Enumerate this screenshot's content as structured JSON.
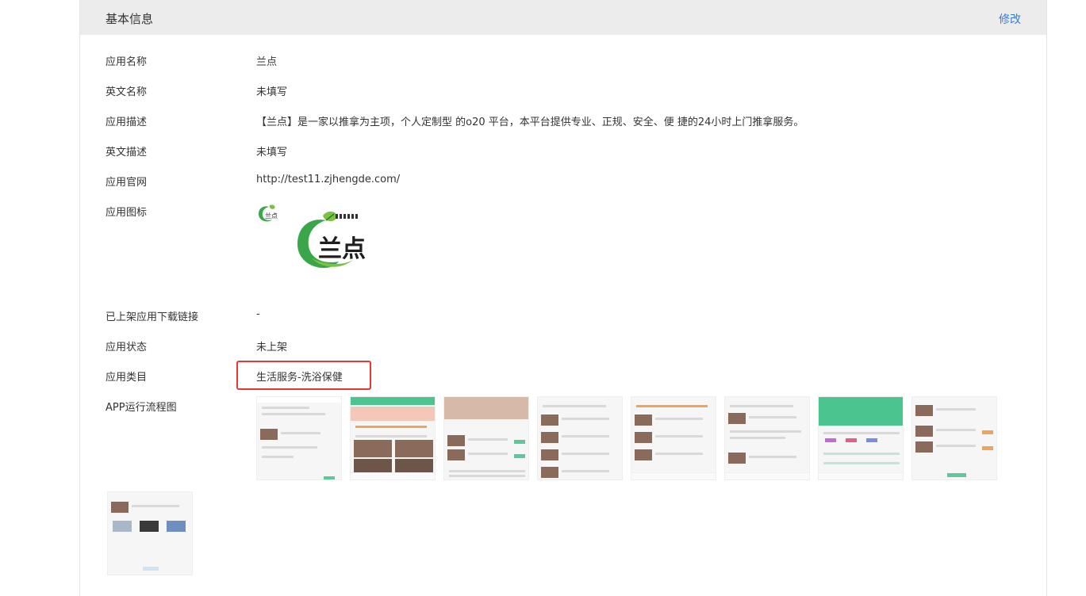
{
  "panel": {
    "title": "基本信息",
    "edit_label": "修改"
  },
  "rows": [
    {
      "label": "应用名称",
      "value": "兰点"
    },
    {
      "label": "英文名称",
      "value": "未填写"
    },
    {
      "label": "应用描述",
      "value": "【兰点】是一家以推拿为主项，个人定制型 的o20 平台，本平台提供专业、正规、安全、便 捷的24小时上门推拿服务。"
    },
    {
      "label": "英文描述",
      "value": "未填写"
    },
    {
      "label": "应用官网",
      "value": "http://test11.zjhengde.com/"
    },
    {
      "label": "应用图标",
      "value": ""
    },
    {
      "label": "已上架应用下载链接",
      "value": "-"
    },
    {
      "label": "应用状态",
      "value": "未上架"
    },
    {
      "label": "应用类目",
      "value": "生活服务-洗浴保健"
    },
    {
      "label": "APP运行流程图",
      "value": ""
    }
  ],
  "icon": {
    "logo_text": "兰点",
    "brand_green": "#3aa64a",
    "accent_green": "#7cc242"
  },
  "colors": {
    "link": "#3a7bd5",
    "highlight": "#e53935",
    "header_bg": "#ececec"
  },
  "screenshots_count": 9
}
